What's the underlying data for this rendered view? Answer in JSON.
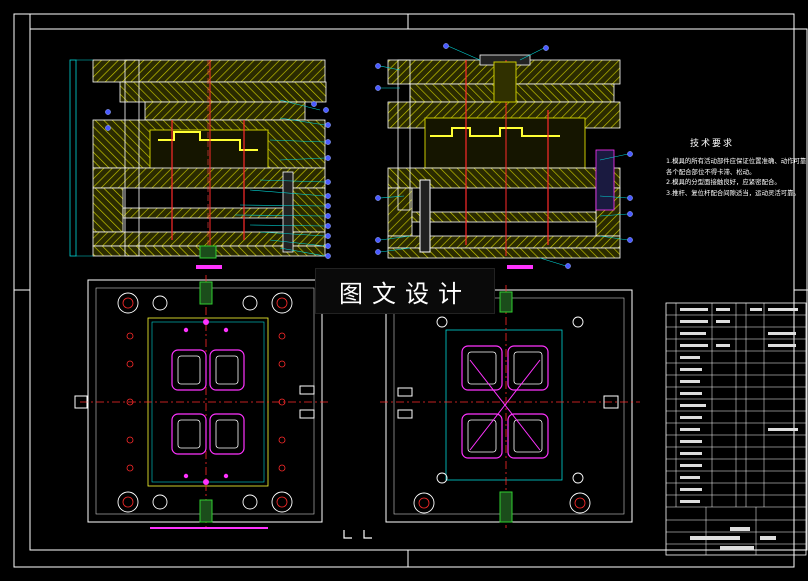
{
  "banner": {
    "text": "图文设计"
  },
  "tech_requirements": {
    "title": "技术要求",
    "notes": [
      "1.模具的所有活动部件应保证位置准确、动作可靠。",
      "各个配合部位不得卡滞、松动。",
      "2.模具的分型面接触良好，应紧密配合。",
      "3.推杆、复位杆配合间隙适当，运动灵活可靠。"
    ]
  },
  "colors": {
    "background": "#000000",
    "frame": "#ffffff",
    "hatch": "#c9c900",
    "cyan": "#00d7d7",
    "red": "#ff2a2a",
    "magenta": "#ff33ff",
    "blue": "#4b5bff",
    "green": "#30d030"
  },
  "icons": {
    "section_view_left": "mold-section-icon",
    "section_view_right": "mold-section-icon",
    "plan_view_left": "mold-plan-icon",
    "plan_view_right": "mold-plan-icon",
    "title_block": "title-block-icon"
  }
}
